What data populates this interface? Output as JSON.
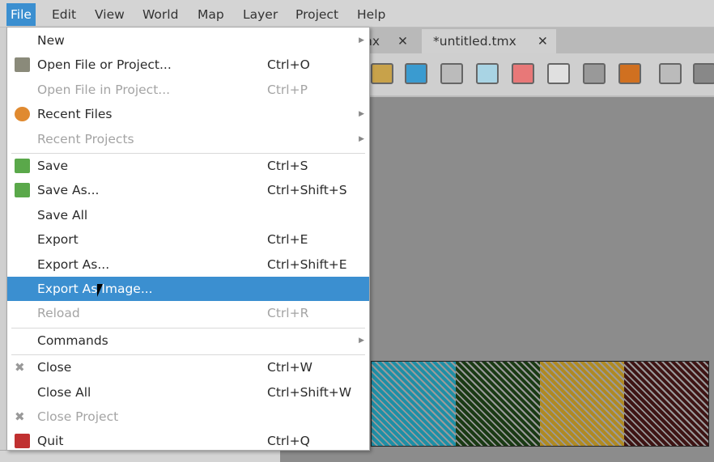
{
  "menubar": [
    "File",
    "Edit",
    "View",
    "World",
    "Map",
    "Layer",
    "Project",
    "Help"
  ],
  "tabs": [
    {
      "label": "nx",
      "close": "✕"
    },
    {
      "label": "*untitled.tmx",
      "close": "✕"
    }
  ],
  "toolbar": [
    "stamp-brush",
    "terrain-brush",
    "bucket-fill",
    "shape-fill",
    "eraser",
    "rectangle-select",
    "magic-wand",
    "select-same-tile",
    "insert-rectangle",
    "edit-polygons"
  ],
  "tiles": [
    {
      "name": "water",
      "color": "#1e8fa6"
    },
    {
      "name": "grass",
      "color": "#1a3a14"
    },
    {
      "name": "sand",
      "color": "#b08a22"
    },
    {
      "name": "dirt",
      "color": "#3e1414"
    }
  ],
  "file_menu": [
    {
      "label": "New",
      "submenu": true
    },
    {
      "label": "Open File or Project...",
      "shortcut": "Ctrl+O",
      "icon": "folder-open-icon"
    },
    {
      "label": "Open File in Project...",
      "shortcut": "Ctrl+P",
      "disabled": true
    },
    {
      "label": "Recent Files",
      "submenu": true,
      "icon": "recent-icon"
    },
    {
      "label": "Recent Projects",
      "submenu": true,
      "disabled": true
    },
    {
      "separator": true
    },
    {
      "label": "Save",
      "shortcut": "Ctrl+S",
      "icon": "save-icon"
    },
    {
      "label": "Save As...",
      "shortcut": "Ctrl+Shift+S",
      "icon": "save-as-icon"
    },
    {
      "label": "Save All"
    },
    {
      "label": "Export",
      "shortcut": "Ctrl+E"
    },
    {
      "label": "Export As...",
      "shortcut": "Ctrl+Shift+E"
    },
    {
      "label": "Export As Image...",
      "highlighted": true
    },
    {
      "label": "Reload",
      "shortcut": "Ctrl+R",
      "disabled": true
    },
    {
      "separator": true
    },
    {
      "label": "Commands",
      "submenu": true
    },
    {
      "separator": true
    },
    {
      "label": "Close",
      "shortcut": "Ctrl+W",
      "icon": "close-icon"
    },
    {
      "label": "Close All",
      "shortcut": "Ctrl+Shift+W"
    },
    {
      "label": "Close Project",
      "disabled": true,
      "icon": "close-icon"
    },
    {
      "label": "Quit",
      "shortcut": "Ctrl+Q",
      "icon": "quit-icon"
    }
  ],
  "colors": {
    "accent": "#3b8fd0"
  }
}
